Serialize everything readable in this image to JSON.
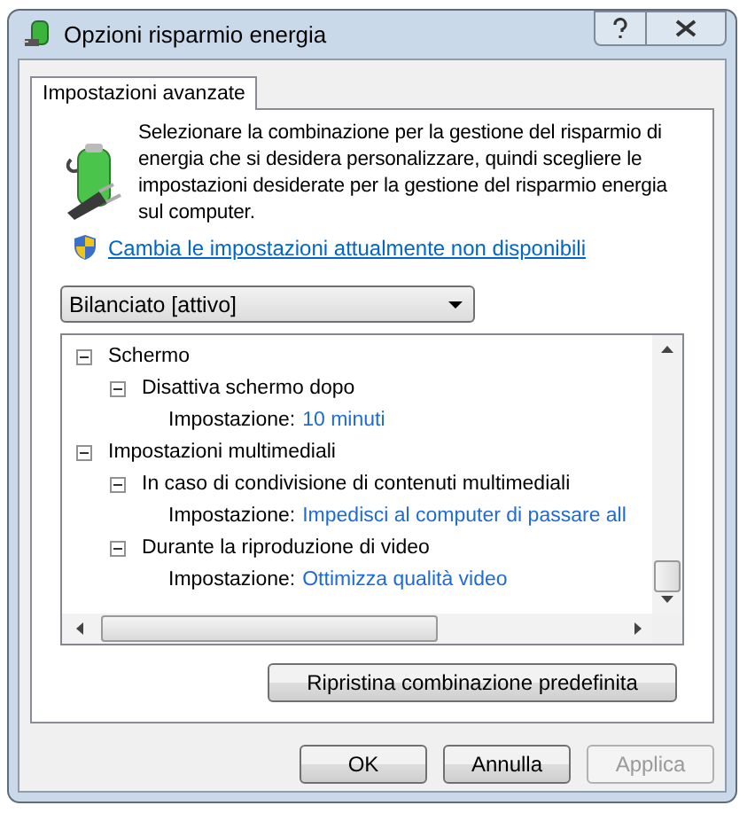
{
  "window": {
    "title": "Opzioni risparmio energia"
  },
  "tabs": [
    {
      "label": "Impostazioni avanzate",
      "selected": true
    }
  ],
  "description": "Selezionare la combinazione per la gestione del risparmio di energia che si desidera personalizzare, quindi scegliere le impostazioni desiderate per la gestione del risparmio energia sul computer.",
  "admin_link": "Cambia le impostazioni attualmente non disponibili",
  "plan_dropdown": {
    "value": "Bilanciato [attivo]"
  },
  "tree": [
    {
      "kind": "group",
      "label": "Schermo",
      "expanded": true,
      "children": [
        {
          "kind": "group",
          "label": "Disattiva schermo dopo",
          "expanded": true,
          "children": [
            {
              "kind": "setting",
              "label": "Impostazione:",
              "value": "10 minuti"
            }
          ]
        }
      ]
    },
    {
      "kind": "group",
      "label": "Impostazioni multimediali",
      "expanded": true,
      "children": [
        {
          "kind": "group",
          "label": "In caso di condivisione di contenuti multimediali",
          "expanded": true,
          "children": [
            {
              "kind": "setting",
              "label": "Impostazione:",
              "value": "Impedisci al computer di passare all"
            }
          ]
        },
        {
          "kind": "group",
          "label": "Durante la riproduzione di video",
          "expanded": true,
          "children": [
            {
              "kind": "setting",
              "label": "Impostazione:",
              "value": "Ottimizza qualità video"
            }
          ]
        }
      ]
    }
  ],
  "restore_button": "Ripristina combinazione predefinita",
  "buttons": [
    {
      "label": "OK",
      "disabled": false
    },
    {
      "label": "Annulla",
      "disabled": false
    },
    {
      "label": "Applica",
      "disabled": true
    }
  ]
}
